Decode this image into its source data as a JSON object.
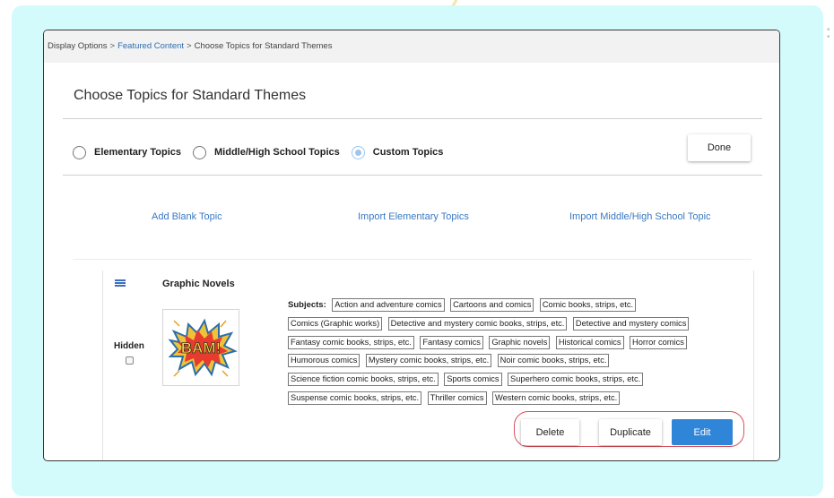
{
  "breadcrumb": {
    "items": [
      "Display Options",
      "Featured Content",
      "Choose Topics for Standard Themes"
    ],
    "separator": ">"
  },
  "page": {
    "title": "Choose Topics for Standard Themes"
  },
  "topic_types": {
    "options": [
      "Elementary Topics",
      "Middle/High School Topics",
      "Custom Topics"
    ],
    "selected": "Custom Topics",
    "done_label": "Done"
  },
  "actions": {
    "add_blank": "Add Blank Topic",
    "import_elementary": "Import Elementary Topics",
    "import_middle_high": "Import Middle/High School Topic"
  },
  "topic": {
    "title": "Graphic Novels",
    "hidden_label": "Hidden",
    "hidden_checked": false,
    "image_text": "BAM!",
    "subjects_label": "Subjects:",
    "subjects": [
      "Action and adventure comics",
      "Cartoons and comics",
      "Comic books, strips, etc.",
      "Comics (Graphic works)",
      "Detective and mystery comic books, strips, etc.",
      "Detective and mystery comics",
      "Fantasy comic books, strips, etc.",
      "Fantasy comics",
      "Graphic novels",
      "Historical comics",
      "Horror comics",
      "Humorous comics",
      "Mystery comic books, strips, etc.",
      "Noir comic books, strips, etc.",
      "Science fiction comic books, strips, etc.",
      "Sports comics",
      "Superhero comic books, strips, etc.",
      "Suspense comic books, strips, etc.",
      "Thriller comics",
      "Western comic books, strips, etc."
    ],
    "buttons": {
      "delete": "Delete",
      "duplicate": "Duplicate",
      "edit": "Edit"
    }
  },
  "colors": {
    "frame": "#d3fbfc",
    "link": "#3a79c2",
    "primary_button": "#2f86d8",
    "highlight_outline": "#d9505a",
    "radio_selected": "#9dc6ee"
  }
}
